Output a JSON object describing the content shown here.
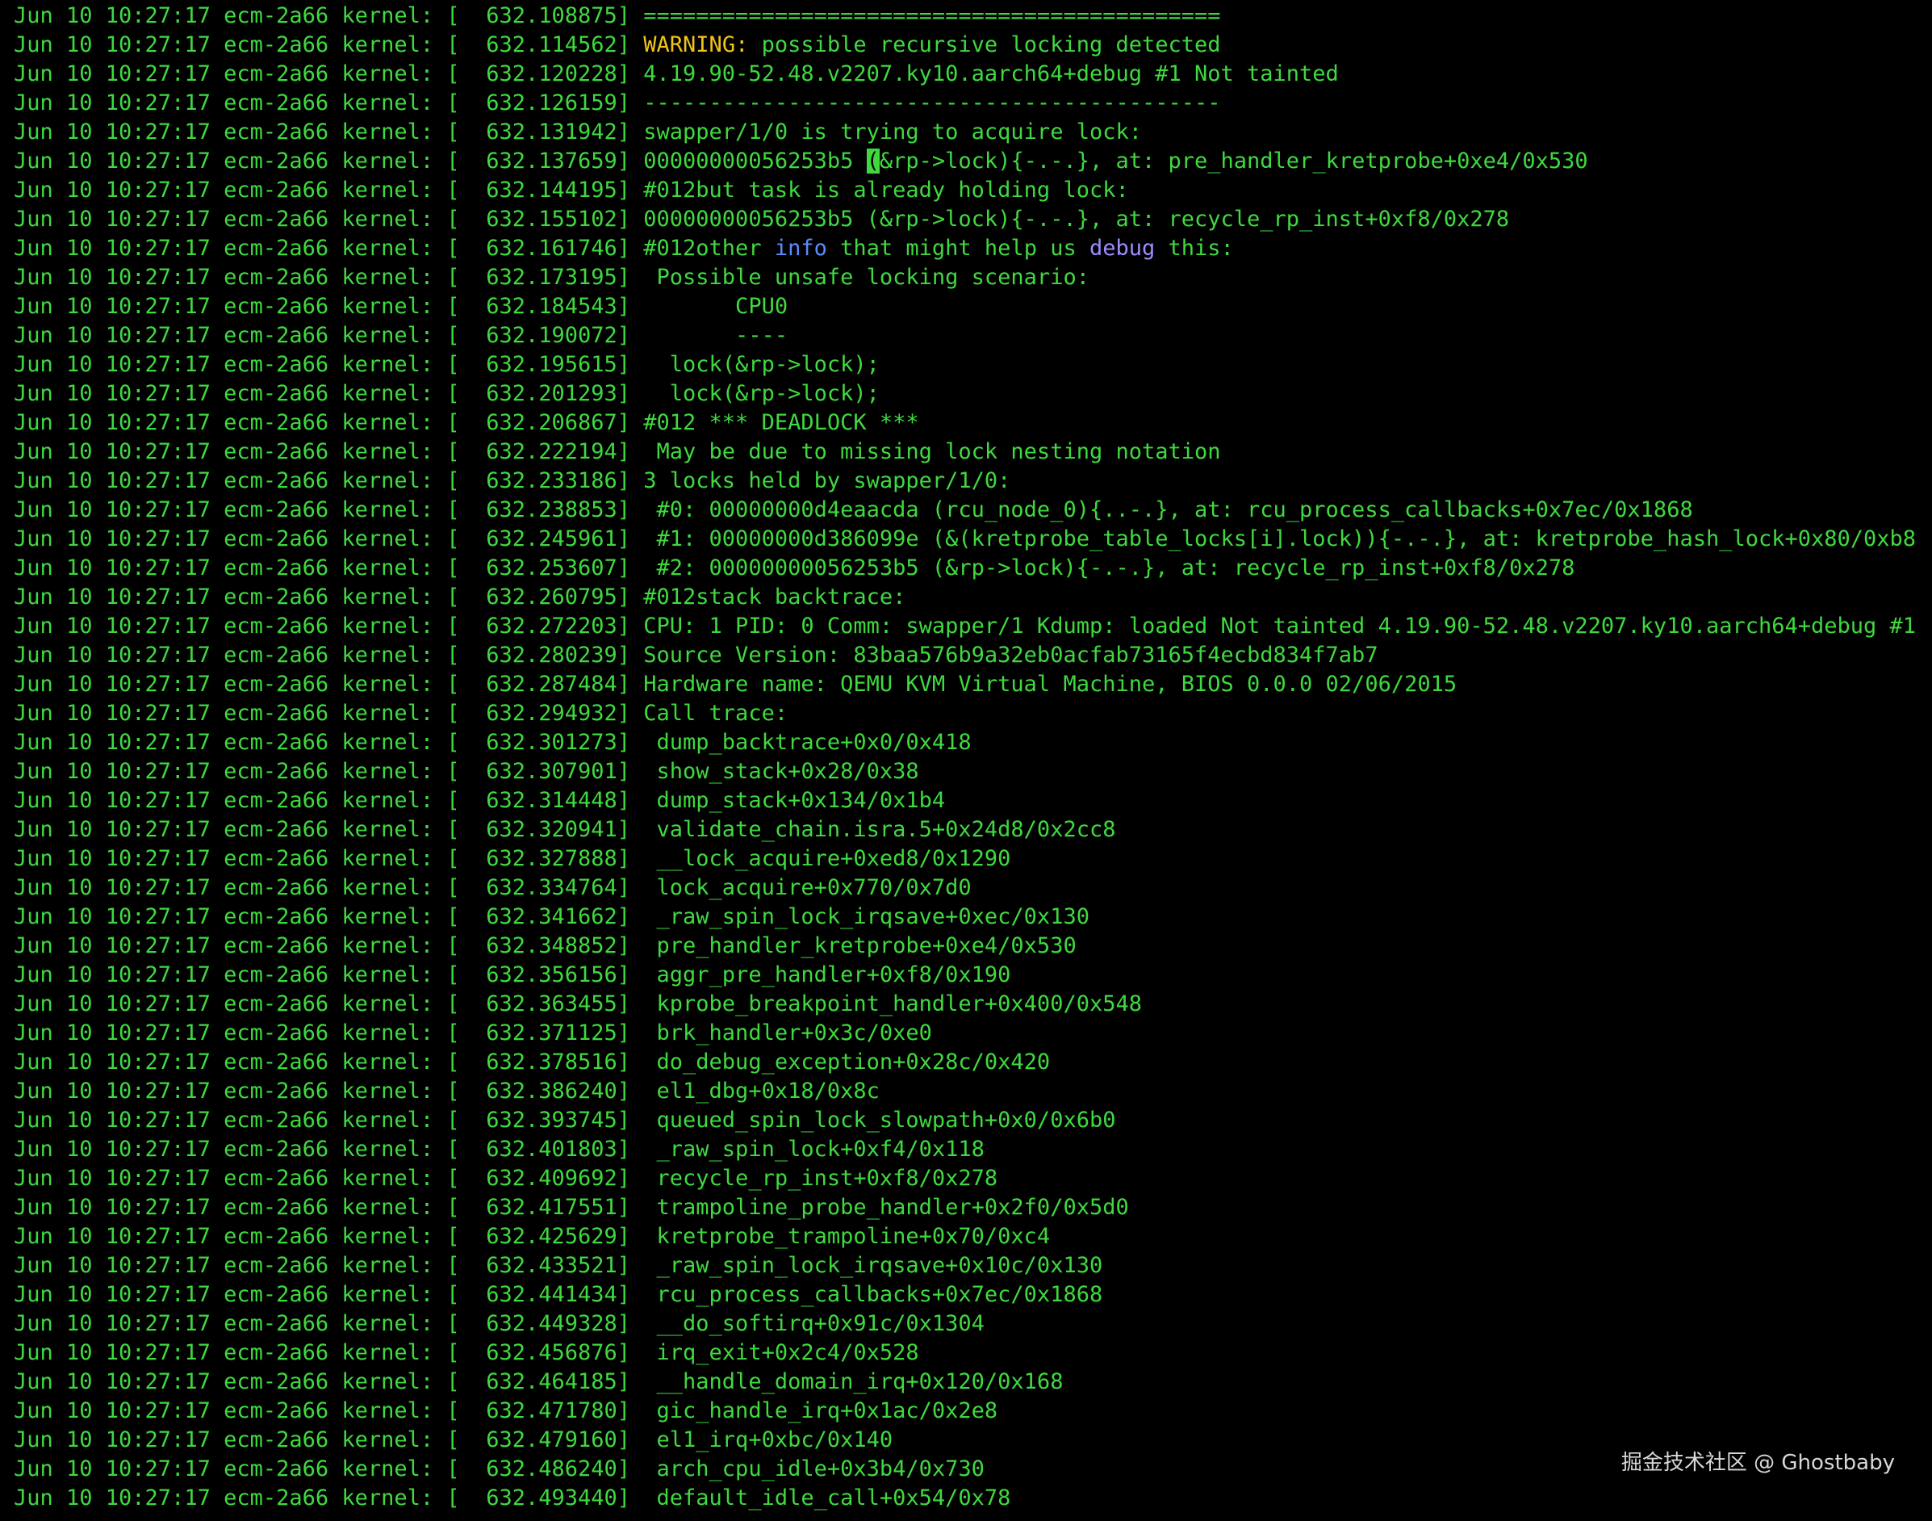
{
  "terminal": {
    "colors": {
      "background": "#000000",
      "text": "#3fd93f",
      "warning": "#f2c31b",
      "info": "#5b8cff",
      "debug": "#9d8cff"
    },
    "lines": [
      {
        "prefix": "Jun 10 10:27:17 ecm-2a66 kernel: [  632.108875]",
        "segments": [
          {
            "text": " ============================================"
          }
        ]
      },
      {
        "prefix": "Jun 10 10:27:17 ecm-2a66 kernel: [  632.114562]",
        "segments": [
          {
            "text": " "
          },
          {
            "text": "WARNING:",
            "style": "warn"
          },
          {
            "text": " possible recursive locking detected"
          }
        ]
      },
      {
        "prefix": "Jun 10 10:27:17 ecm-2a66 kernel: [  632.120228]",
        "segments": [
          {
            "text": " 4.19.90-52.48.v2207.ky10.aarch64+debug #1 Not tainted"
          }
        ]
      },
      {
        "prefix": "Jun 10 10:27:17 ecm-2a66 kernel: [  632.126159]",
        "segments": [
          {
            "text": " --------------------------------------------"
          }
        ]
      },
      {
        "prefix": "Jun 10 10:27:17 ecm-2a66 kernel: [  632.131942]",
        "segments": [
          {
            "text": " swapper/1/0 is trying to acquire lock:"
          }
        ]
      },
      {
        "prefix": "Jun 10 10:27:17 ecm-2a66 kernel: [  632.137659]",
        "segments": [
          {
            "text": " 00000000056253b5 "
          },
          {
            "text": "(",
            "style": "cursor"
          },
          {
            "text": "&rp->lock){-.-.}, at: pre_handler_kretprobe+0xe4/0x530"
          }
        ]
      },
      {
        "prefix": "Jun 10 10:27:17 ecm-2a66 kernel: [  632.144195]",
        "segments": [
          {
            "text": " #012but task is already holding lock:"
          }
        ]
      },
      {
        "prefix": "Jun 10 10:27:17 ecm-2a66 kernel: [  632.155102]",
        "segments": [
          {
            "text": " 00000000056253b5 (&rp->lock){-.-.}, at: recycle_rp_inst+0xf8/0x278"
          }
        ]
      },
      {
        "prefix": "Jun 10 10:27:17 ecm-2a66 kernel: [  632.161746]",
        "segments": [
          {
            "text": " #012other "
          },
          {
            "text": "info",
            "style": "blue"
          },
          {
            "text": " that might help us "
          },
          {
            "text": "debug",
            "style": "purple"
          },
          {
            "text": " this:"
          }
        ]
      },
      {
        "prefix": "Jun 10 10:27:17 ecm-2a66 kernel: [  632.173195]",
        "segments": [
          {
            "text": "  Possible unsafe locking scenario:"
          }
        ]
      },
      {
        "prefix": "Jun 10 10:27:17 ecm-2a66 kernel: [  632.184543]",
        "segments": [
          {
            "text": "        CPU0"
          }
        ]
      },
      {
        "prefix": "Jun 10 10:27:17 ecm-2a66 kernel: [  632.190072]",
        "segments": [
          {
            "text": "        ----"
          }
        ]
      },
      {
        "prefix": "Jun 10 10:27:17 ecm-2a66 kernel: [  632.195615]",
        "segments": [
          {
            "text": "   lock(&rp->lock);"
          }
        ]
      },
      {
        "prefix": "Jun 10 10:27:17 ecm-2a66 kernel: [  632.201293]",
        "segments": [
          {
            "text": "   lock(&rp->lock);"
          }
        ]
      },
      {
        "prefix": "Jun 10 10:27:17 ecm-2a66 kernel: [  632.206867]",
        "segments": [
          {
            "text": " #012 *** DEADLOCK ***"
          }
        ]
      },
      {
        "prefix": "Jun 10 10:27:17 ecm-2a66 kernel: [  632.222194]",
        "segments": [
          {
            "text": "  May be due to missing lock nesting notation"
          }
        ]
      },
      {
        "prefix": "Jun 10 10:27:17 ecm-2a66 kernel: [  632.233186]",
        "segments": [
          {
            "text": " 3 locks held by swapper/1/0:"
          }
        ]
      },
      {
        "prefix": "Jun 10 10:27:17 ecm-2a66 kernel: [  632.238853]",
        "segments": [
          {
            "text": "  #0: 00000000d4eaacda (rcu_node_0){..-.}, at: rcu_process_callbacks+0x7ec/0x1868"
          }
        ]
      },
      {
        "prefix": "Jun 10 10:27:17 ecm-2a66 kernel: [  632.245961]",
        "segments": [
          {
            "text": "  #1: 00000000d386099e (&(kretprobe_table_locks[i].lock)){-.-.}, at: kretprobe_hash_lock+0x80/0xb8"
          }
        ]
      },
      {
        "prefix": "Jun 10 10:27:17 ecm-2a66 kernel: [  632.253607]",
        "segments": [
          {
            "text": "  #2: 00000000056253b5 (&rp->lock){-.-.}, at: recycle_rp_inst+0xf8/0x278"
          }
        ]
      },
      {
        "prefix": "Jun 10 10:27:17 ecm-2a66 kernel: [  632.260795]",
        "segments": [
          {
            "text": " #012stack backtrace:"
          }
        ]
      },
      {
        "prefix": "Jun 10 10:27:17 ecm-2a66 kernel: [  632.272203]",
        "segments": [
          {
            "text": " CPU: 1 PID: 0 Comm: swapper/1 Kdump: loaded Not tainted 4.19.90-52.48.v2207.ky10.aarch64+debug #1"
          }
        ]
      },
      {
        "prefix": "Jun 10 10:27:17 ecm-2a66 kernel: [  632.280239]",
        "segments": [
          {
            "text": " Source Version: 83baa576b9a32eb0acfab73165f4ecbd834f7ab7"
          }
        ]
      },
      {
        "prefix": "Jun 10 10:27:17 ecm-2a66 kernel: [  632.287484]",
        "segments": [
          {
            "text": " Hardware name: QEMU KVM Virtual Machine, BIOS 0.0.0 02/06/2015"
          }
        ]
      },
      {
        "prefix": "Jun 10 10:27:17 ecm-2a66 kernel: [  632.294932]",
        "segments": [
          {
            "text": " Call trace:"
          }
        ]
      },
      {
        "prefix": "Jun 10 10:27:17 ecm-2a66 kernel: [  632.301273]",
        "segments": [
          {
            "text": "  dump_backtrace+0x0/0x418"
          }
        ]
      },
      {
        "prefix": "Jun 10 10:27:17 ecm-2a66 kernel: [  632.307901]",
        "segments": [
          {
            "text": "  show_stack+0x28/0x38"
          }
        ]
      },
      {
        "prefix": "Jun 10 10:27:17 ecm-2a66 kernel: [  632.314448]",
        "segments": [
          {
            "text": "  dump_stack+0x134/0x1b4"
          }
        ]
      },
      {
        "prefix": "Jun 10 10:27:17 ecm-2a66 kernel: [  632.320941]",
        "segments": [
          {
            "text": "  validate_chain.isra.5+0x24d8/0x2cc8"
          }
        ]
      },
      {
        "prefix": "Jun 10 10:27:17 ecm-2a66 kernel: [  632.327888]",
        "segments": [
          {
            "text": "  __lock_acquire+0xed8/0x1290"
          }
        ]
      },
      {
        "prefix": "Jun 10 10:27:17 ecm-2a66 kernel: [  632.334764]",
        "segments": [
          {
            "text": "  lock_acquire+0x770/0x7d0"
          }
        ]
      },
      {
        "prefix": "Jun 10 10:27:17 ecm-2a66 kernel: [  632.341662]",
        "segments": [
          {
            "text": "  _raw_spin_lock_irqsave+0xec/0x130"
          }
        ]
      },
      {
        "prefix": "Jun 10 10:27:17 ecm-2a66 kernel: [  632.348852]",
        "segments": [
          {
            "text": "  pre_handler_kretprobe+0xe4/0x530"
          }
        ]
      },
      {
        "prefix": "Jun 10 10:27:17 ecm-2a66 kernel: [  632.356156]",
        "segments": [
          {
            "text": "  aggr_pre_handler+0xf8/0x190"
          }
        ]
      },
      {
        "prefix": "Jun 10 10:27:17 ecm-2a66 kernel: [  632.363455]",
        "segments": [
          {
            "text": "  kprobe_breakpoint_handler+0x400/0x548"
          }
        ]
      },
      {
        "prefix": "Jun 10 10:27:17 ecm-2a66 kernel: [  632.371125]",
        "segments": [
          {
            "text": "  brk_handler+0x3c/0xe0"
          }
        ]
      },
      {
        "prefix": "Jun 10 10:27:17 ecm-2a66 kernel: [  632.378516]",
        "segments": [
          {
            "text": "  do_debug_exception+0x28c/0x420"
          }
        ]
      },
      {
        "prefix": "Jun 10 10:27:17 ecm-2a66 kernel: [  632.386240]",
        "segments": [
          {
            "text": "  el1_dbg+0x18/0x8c"
          }
        ]
      },
      {
        "prefix": "Jun 10 10:27:17 ecm-2a66 kernel: [  632.393745]",
        "segments": [
          {
            "text": "  queued_spin_lock_slowpath+0x0/0x6b0"
          }
        ]
      },
      {
        "prefix": "Jun 10 10:27:17 ecm-2a66 kernel: [  632.401803]",
        "segments": [
          {
            "text": "  _raw_spin_lock+0xf4/0x118"
          }
        ]
      },
      {
        "prefix": "Jun 10 10:27:17 ecm-2a66 kernel: [  632.409692]",
        "segments": [
          {
            "text": "  recycle_rp_inst+0xf8/0x278"
          }
        ]
      },
      {
        "prefix": "Jun 10 10:27:17 ecm-2a66 kernel: [  632.417551]",
        "segments": [
          {
            "text": "  trampoline_probe_handler+0x2f0/0x5d0"
          }
        ]
      },
      {
        "prefix": "Jun 10 10:27:17 ecm-2a66 kernel: [  632.425629]",
        "segments": [
          {
            "text": "  kretprobe_trampoline+0x70/0xc4"
          }
        ]
      },
      {
        "prefix": "Jun 10 10:27:17 ecm-2a66 kernel: [  632.433521]",
        "segments": [
          {
            "text": "  _raw_spin_lock_irqsave+0x10c/0x130"
          }
        ]
      },
      {
        "prefix": "Jun 10 10:27:17 ecm-2a66 kernel: [  632.441434]",
        "segments": [
          {
            "text": "  rcu_process_callbacks+0x7ec/0x1868"
          }
        ]
      },
      {
        "prefix": "Jun 10 10:27:17 ecm-2a66 kernel: [  632.449328]",
        "segments": [
          {
            "text": "  __do_softirq+0x91c/0x1304"
          }
        ]
      },
      {
        "prefix": "Jun 10 10:27:17 ecm-2a66 kernel: [  632.456876]",
        "segments": [
          {
            "text": "  irq_exit+0x2c4/0x528"
          }
        ]
      },
      {
        "prefix": "Jun 10 10:27:17 ecm-2a66 kernel: [  632.464185]",
        "segments": [
          {
            "text": "  __handle_domain_irq+0x120/0x168"
          }
        ]
      },
      {
        "prefix": "Jun 10 10:27:17 ecm-2a66 kernel: [  632.471780]",
        "segments": [
          {
            "text": "  gic_handle_irq+0x1ac/0x2e8"
          }
        ]
      },
      {
        "prefix": "Jun 10 10:27:17 ecm-2a66 kernel: [  632.479160]",
        "segments": [
          {
            "text": "  el1_irq+0xbc/0x140"
          }
        ]
      },
      {
        "prefix": "Jun 10 10:27:17 ecm-2a66 kernel: [  632.486240]",
        "segments": [
          {
            "text": "  arch_cpu_idle+0x3b4/0x730"
          }
        ]
      },
      {
        "prefix": "Jun 10 10:27:17 ecm-2a66 kernel: [  632.493440]",
        "segments": [
          {
            "text": "  default_idle_call+0x54/0x78"
          }
        ]
      }
    ]
  },
  "watermark": {
    "text": "掘金技术社区 @ Ghostbaby"
  }
}
